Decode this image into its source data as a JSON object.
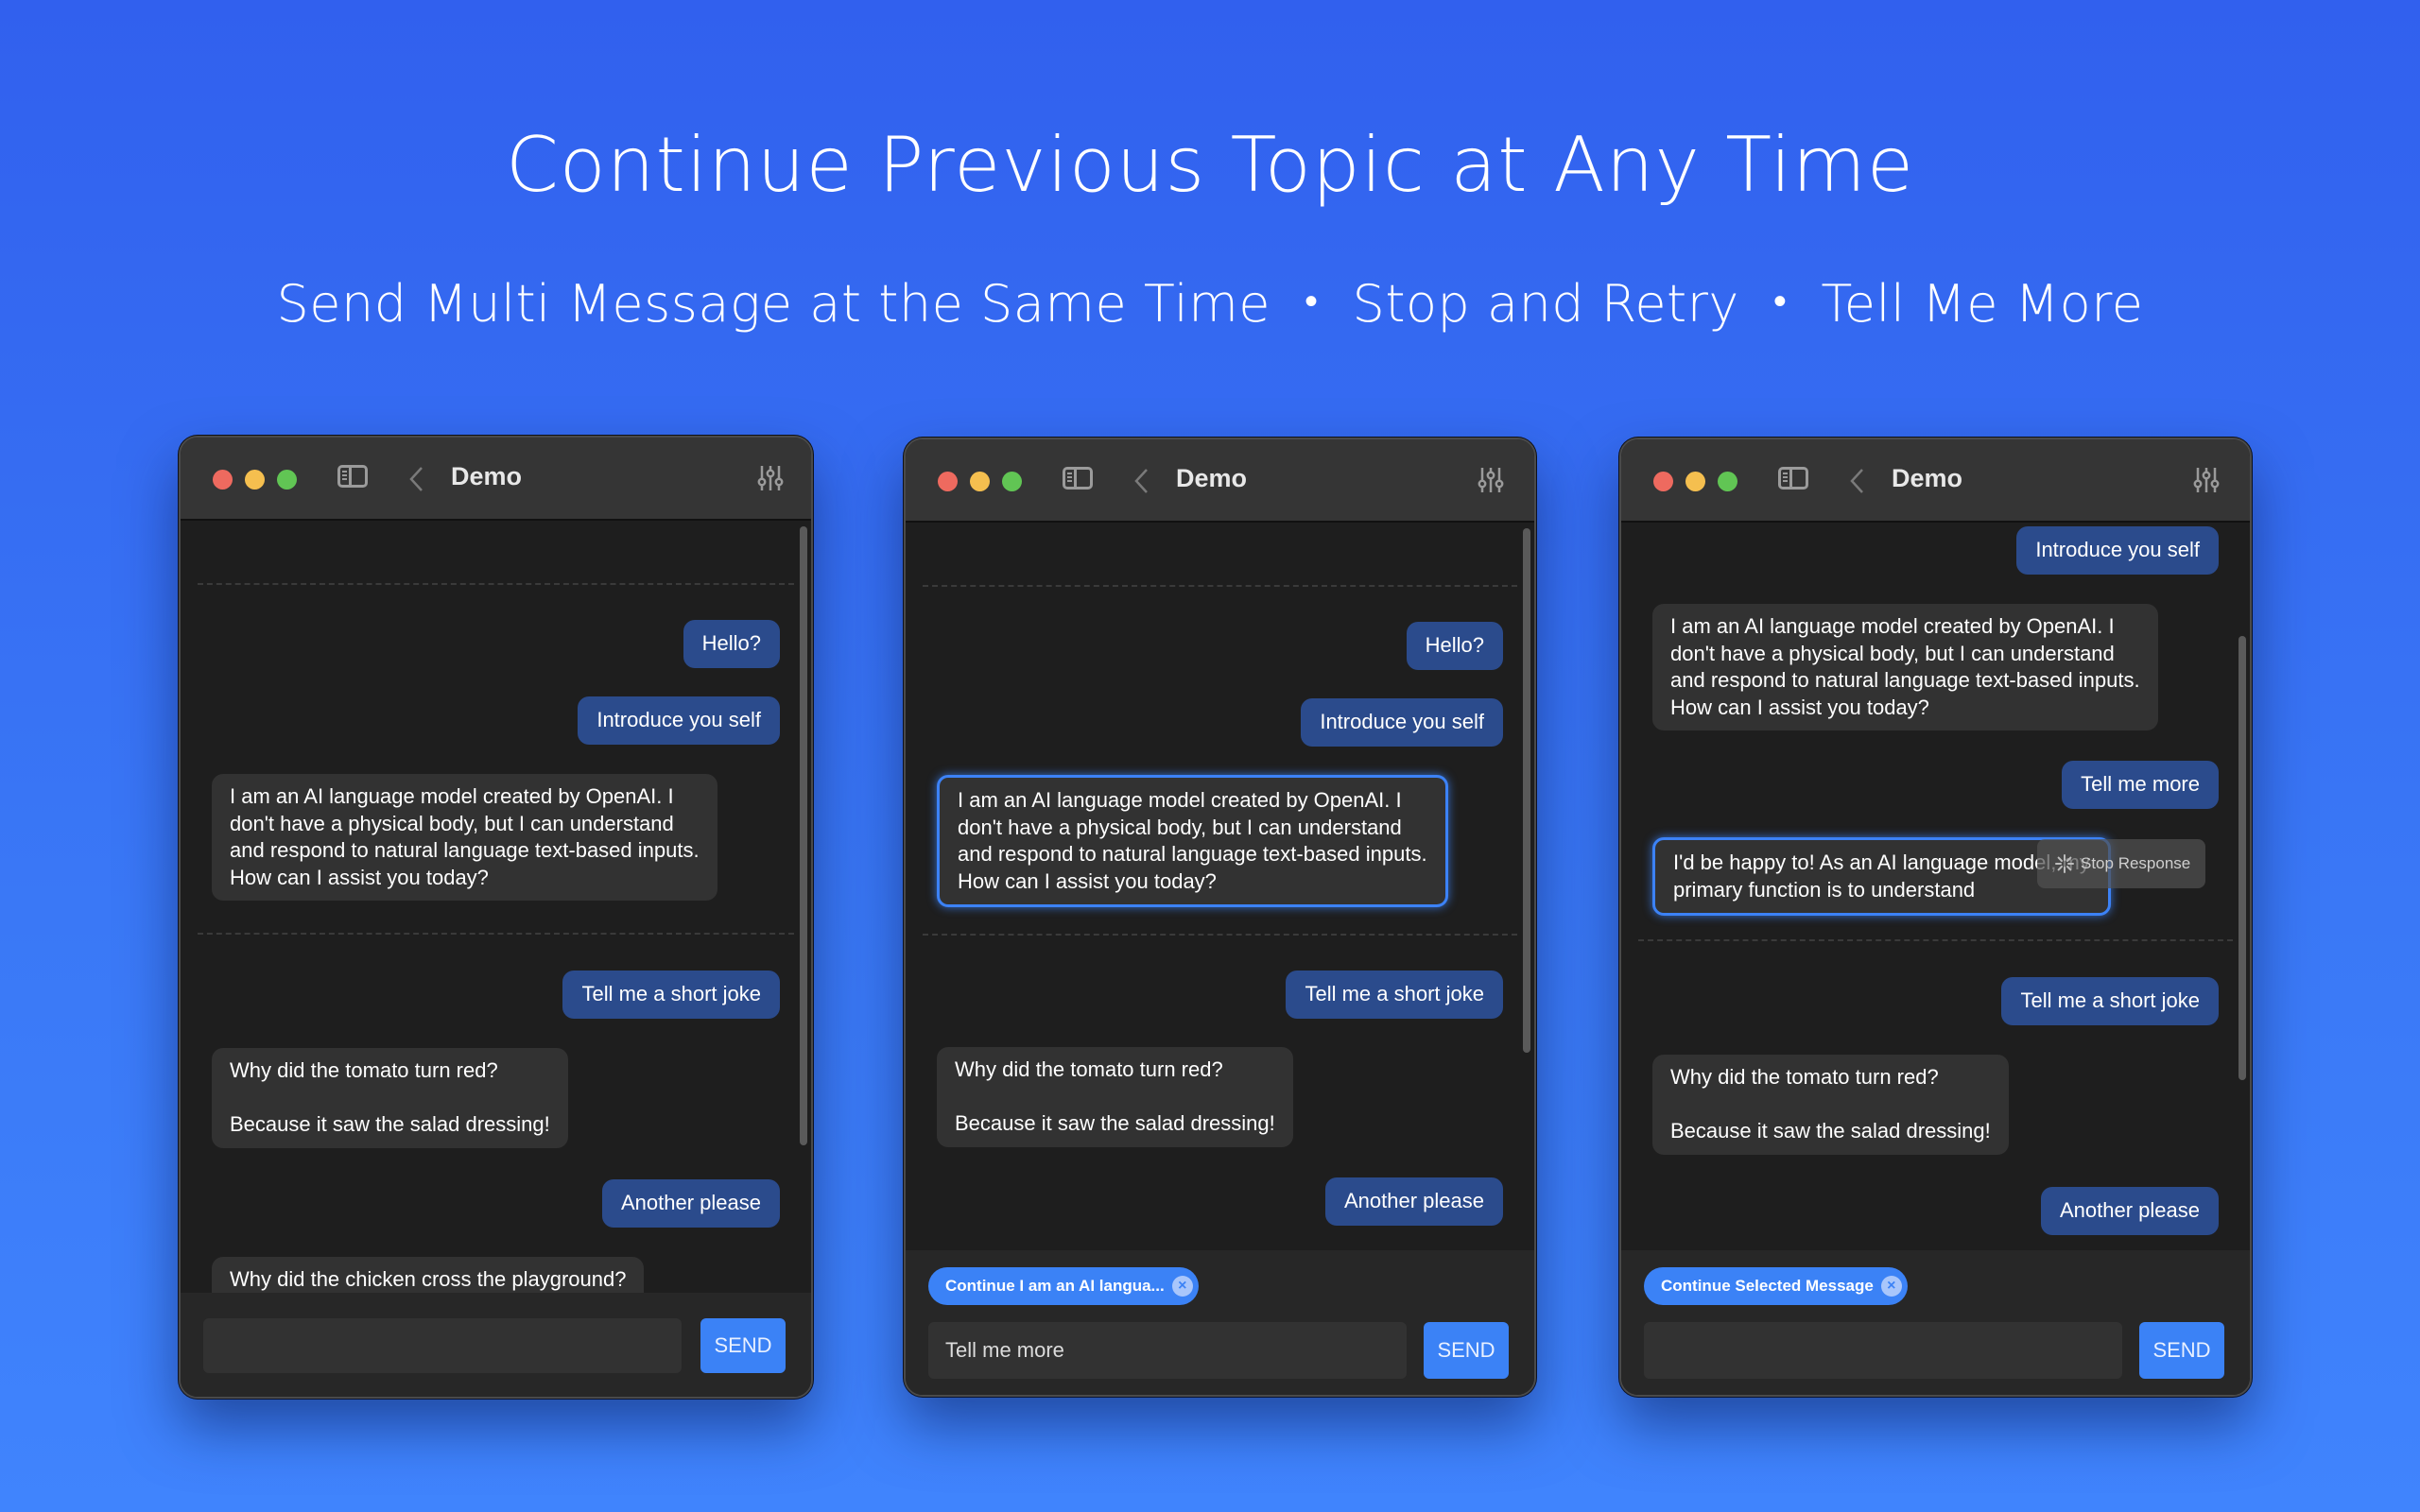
{
  "headline": "Continue Previous Topic at Any Time",
  "subline": {
    "items": [
      "Send Multi Message at the Same Time",
      "Stop and Retry",
      "Tell Me More"
    ],
    "separator": "•"
  },
  "colors": {
    "accent": "#3b82f6",
    "user_bubble": "#2b4b8c",
    "bot_bubble": "#323232",
    "window_bg": "#1e1e1e",
    "titlebar": "#353535"
  },
  "windows": [
    {
      "title": "Demo",
      "icons": [
        "close-button",
        "minimize-button",
        "zoom-button",
        "sidebar-toggle-icon",
        "back-chevron-icon",
        "sliders-icon"
      ],
      "messages": [
        {
          "role": "user",
          "text": "Hello?"
        },
        {
          "role": "user",
          "text": "Introduce you self"
        },
        {
          "role": "assistant",
          "text": "I am an AI language model created by OpenAI. I\ndon't have a physical body, but I can understand\nand respond to natural language text-based inputs.\nHow can I assist you today?"
        },
        {
          "role": "user",
          "text": "Tell me a short joke"
        },
        {
          "role": "assistant",
          "text": "Why did the tomato turn red?\n\nBecause it saw the salad dressing!"
        },
        {
          "role": "user",
          "text": "Another please"
        },
        {
          "role": "assistant",
          "text": "Why did the chicken cross the playground?"
        }
      ],
      "input": {
        "value": "",
        "placeholder": ""
      },
      "send_label": "SEND"
    },
    {
      "title": "Demo",
      "messages": [
        {
          "role": "user",
          "text": "Hello?"
        },
        {
          "role": "user",
          "text": "Introduce you self"
        },
        {
          "role": "assistant",
          "selected": true,
          "text": "I am an AI language model created by OpenAI. I\ndon't have a physical body, but I can understand\nand respond to natural language text-based inputs.\nHow can I assist you today?"
        },
        {
          "role": "user",
          "text": "Tell me a short joke"
        },
        {
          "role": "assistant",
          "text": "Why did the tomato turn red?\n\nBecause it saw the salad dressing!"
        },
        {
          "role": "user",
          "text": "Another please"
        }
      ],
      "chip": {
        "label": "Continue I am an AI langua...",
        "close": "×"
      },
      "input": {
        "value": "Tell me more",
        "placeholder": ""
      },
      "send_label": "SEND"
    },
    {
      "title": "Demo",
      "messages": [
        {
          "role": "user",
          "text": "Introduce you self"
        },
        {
          "role": "assistant",
          "text": "I am an AI language model created by OpenAI. I\ndon't have a physical body, but I can understand\nand respond to natural language text-based inputs.\nHow can I assist you today?"
        },
        {
          "role": "user",
          "text": "Tell me more"
        },
        {
          "role": "assistant",
          "selected": true,
          "streaming": true,
          "text": "I'd be happy to! As an AI language model, my\nprimary function is to understand"
        },
        {
          "role": "user",
          "text": "Tell me a short joke"
        },
        {
          "role": "assistant",
          "text": "Why did the tomato turn red?\n\nBecause it saw the salad dressing!"
        },
        {
          "role": "user",
          "text": "Another please"
        }
      ],
      "stop_button": {
        "label": "Stop Response"
      },
      "chip": {
        "label": "Continue Selected Message",
        "close": "×"
      },
      "input": {
        "value": "",
        "placeholder": ""
      },
      "send_label": "SEND"
    }
  ]
}
